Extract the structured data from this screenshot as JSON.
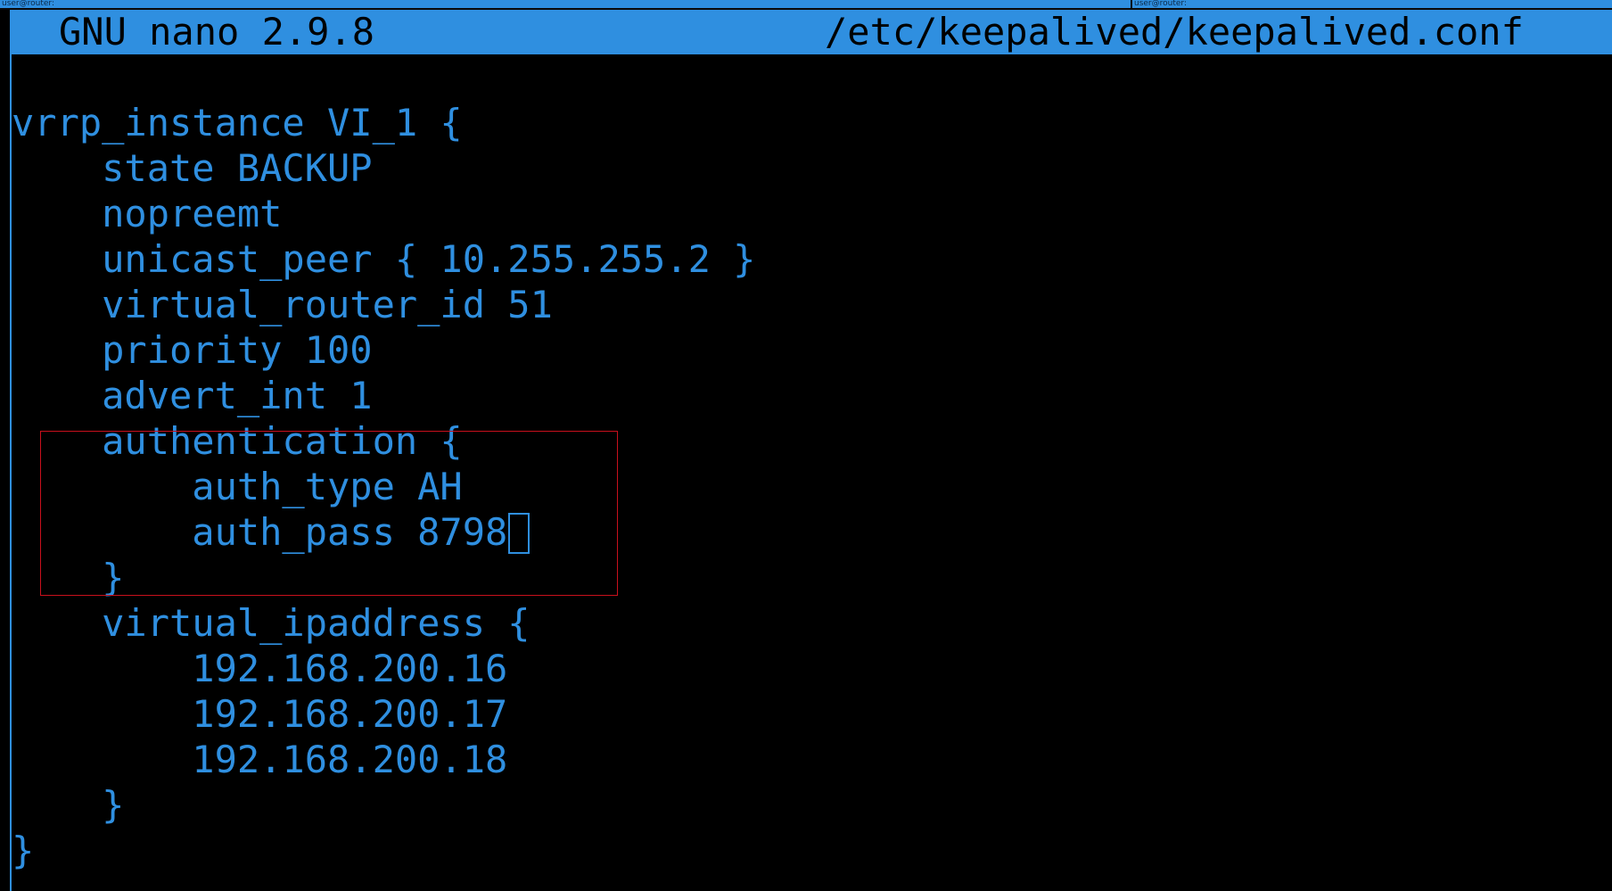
{
  "window": {
    "left_tab_label": "user@router:",
    "right_tab_label": "user@router:"
  },
  "titlebar": {
    "app_version": "GNU nano 2.9.8",
    "file_path": "/etc/keepalived/keepalived.conf"
  },
  "editor": {
    "lines": [
      "vrrp_instance VI_1 {",
      "    state BACKUP",
      "    nopreemt",
      "    unicast_peer { 10.255.255.2 }",
      "    virtual_router_id 51",
      "    priority 100",
      "    advert_int 1",
      "    authentication {",
      "        auth_type AH",
      "        auth_pass 8798",
      "    }",
      "    virtual_ipaddress {",
      "        192.168.200.16",
      "        192.168.200.17",
      "        192.168.200.18",
      "    }",
      "}"
    ],
    "cursor_line": 9
  },
  "colors": {
    "text": "#2f8fe0",
    "background": "#000000",
    "titlebar": "#2f8fe0",
    "highlight_box": "#c8101c"
  }
}
